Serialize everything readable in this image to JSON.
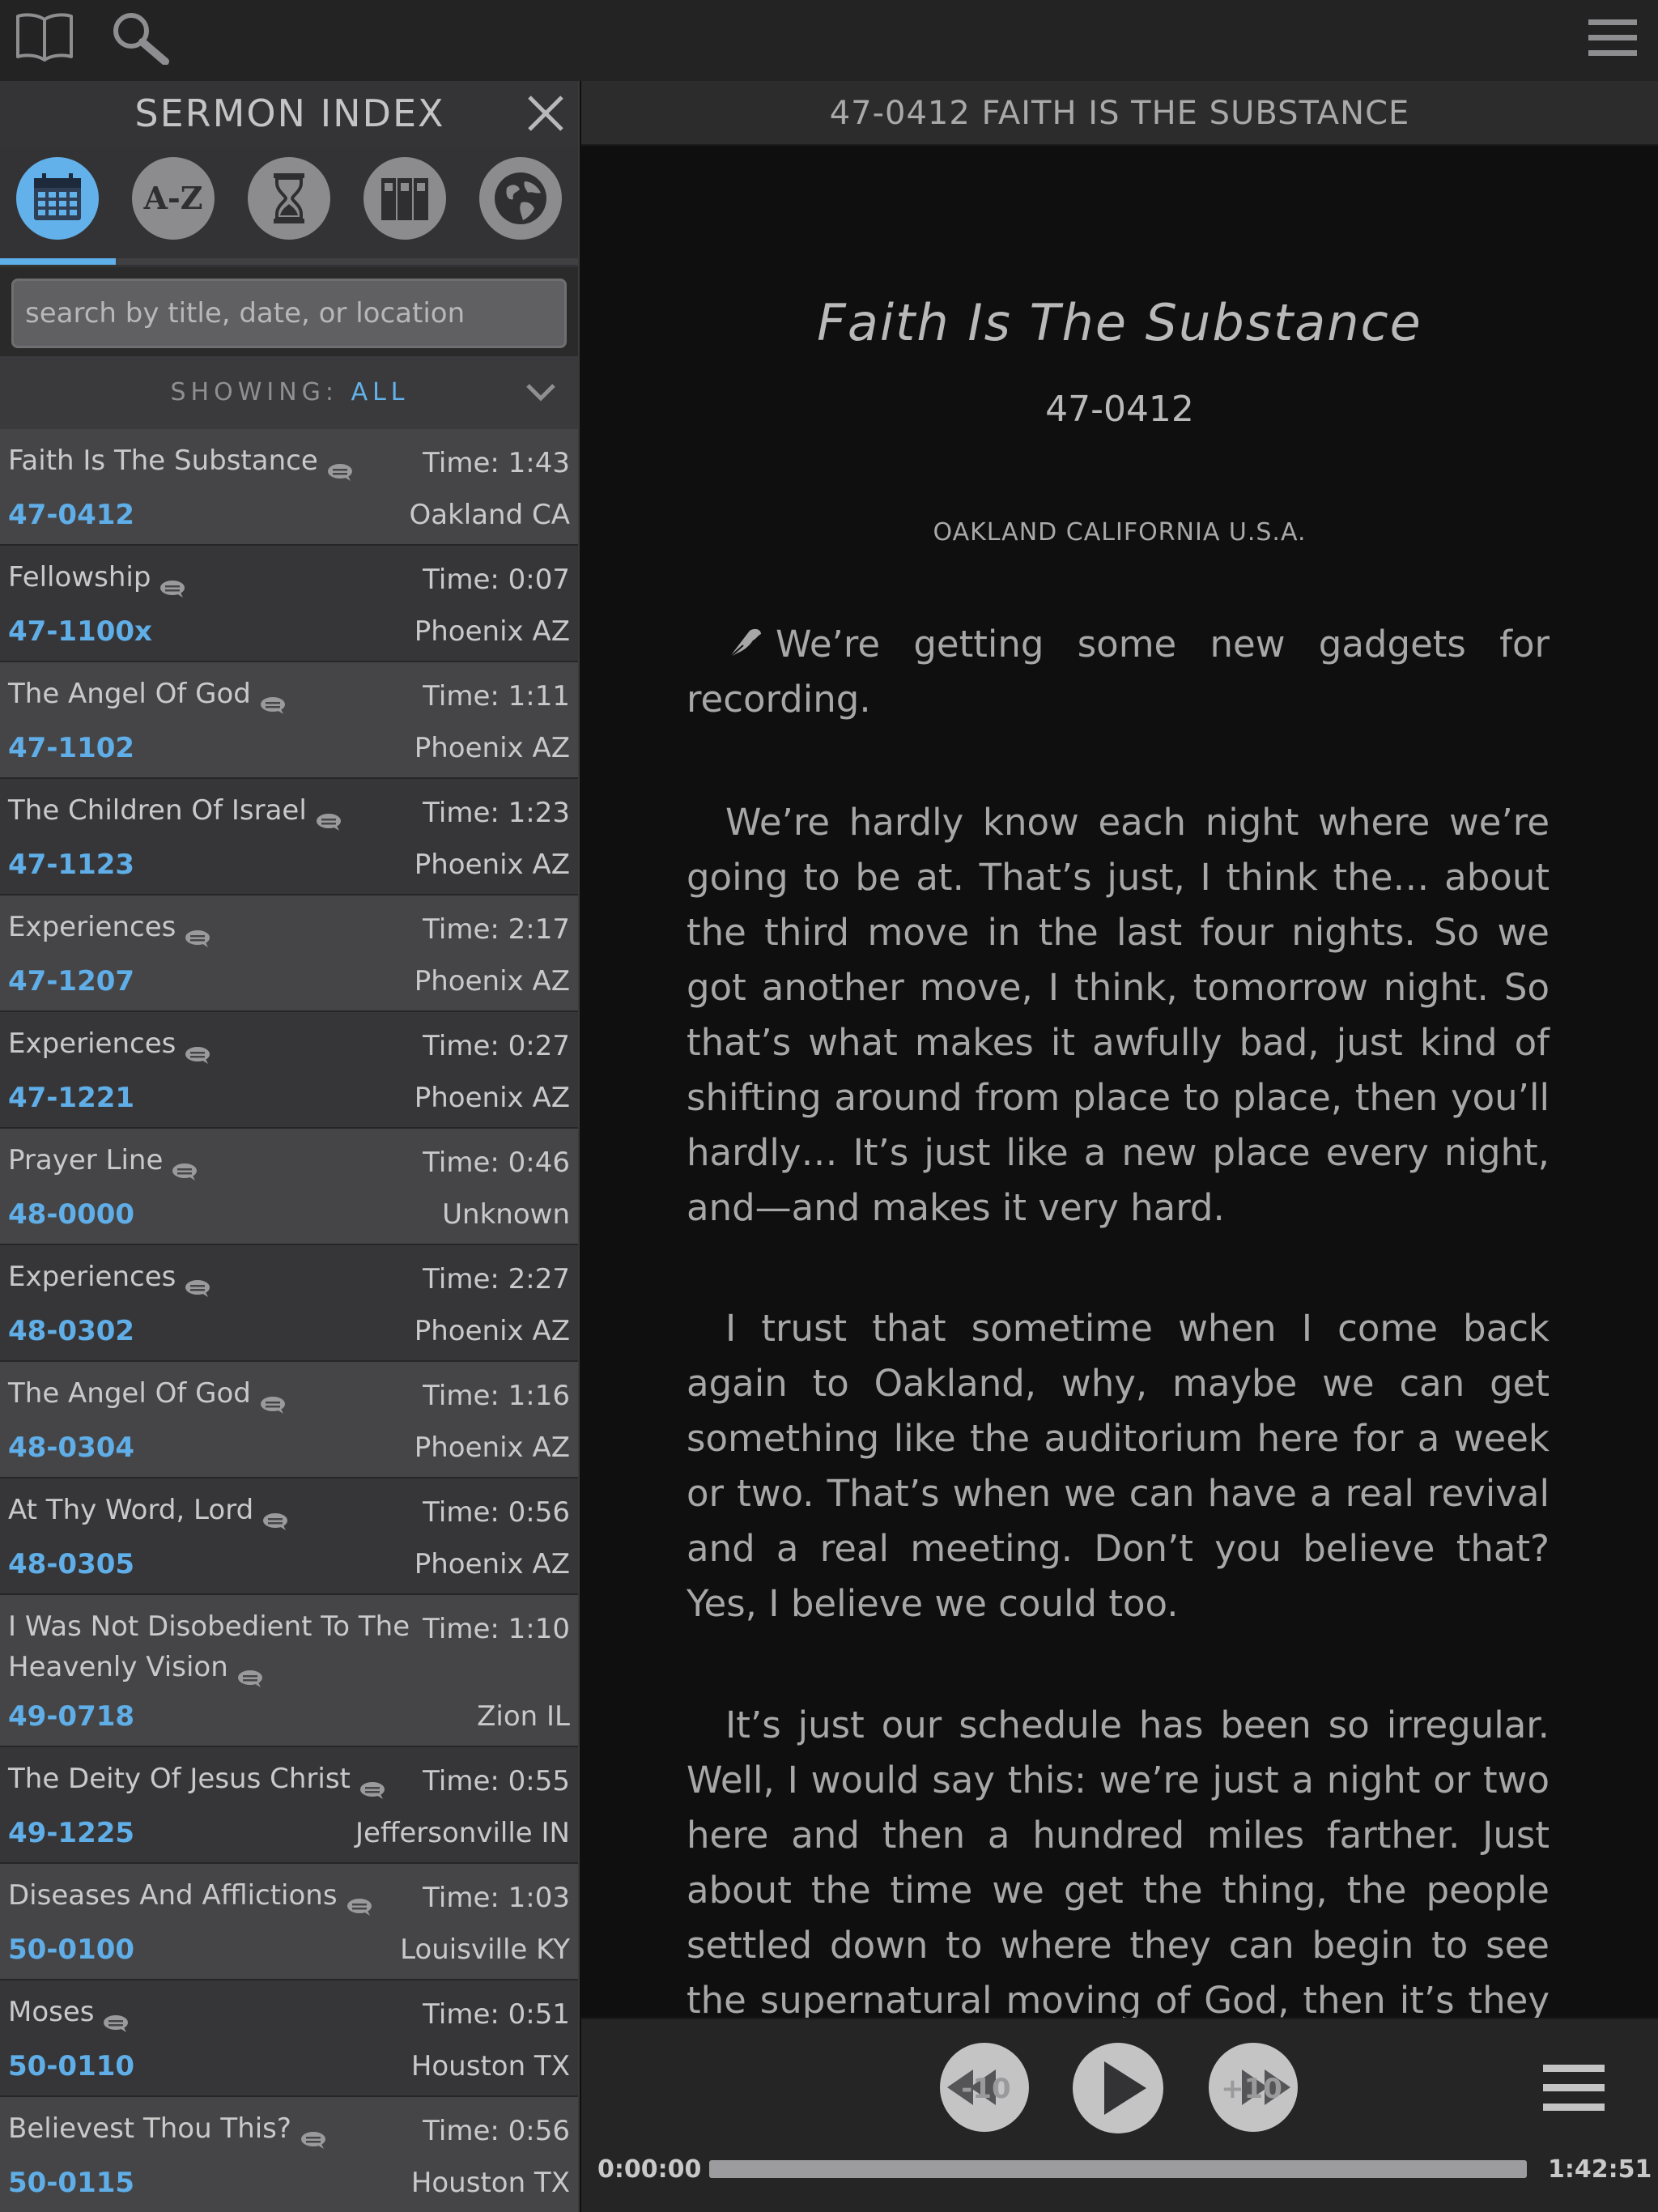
{
  "icons": {
    "book": "book-icon",
    "search": "search-icon",
    "menu": "hamburger-menu-icon",
    "close": "close-icon",
    "chevron": "chevron-down-icon",
    "comment": "comment-bubble-icon"
  },
  "colors": {
    "accent": "#63b1ea",
    "topbar": "#232324",
    "reader_bg": "#0f0f10",
    "row_light": "#454547",
    "row_dark": "#363638"
  },
  "sidebar": {
    "title": "SERMON INDEX",
    "tabs": [
      {
        "name": "date",
        "label": "",
        "active": true
      },
      {
        "name": "a-z",
        "label": "A-Z",
        "active": false
      },
      {
        "name": "duration",
        "label": "",
        "active": false
      },
      {
        "name": "series",
        "label": "",
        "active": false
      },
      {
        "name": "location",
        "label": "",
        "active": false
      }
    ],
    "search_placeholder": "search by title, date, or location",
    "showing_label": "SHOWING:",
    "showing_value": "ALL",
    "sermons": [
      {
        "title": "Faith Is The Substance",
        "code": "47-0412",
        "time": "Time: 1:43",
        "location": "Oakland CA"
      },
      {
        "title": "Fellowship",
        "code": "47-1100x",
        "time": "Time: 0:07",
        "location": "Phoenix AZ"
      },
      {
        "title": "The Angel Of God",
        "code": "47-1102",
        "time": "Time: 1:11",
        "location": "Phoenix AZ"
      },
      {
        "title": "The Children Of Israel",
        "code": "47-1123",
        "time": "Time: 1:23",
        "location": "Phoenix AZ"
      },
      {
        "title": "Experiences",
        "code": "47-1207",
        "time": "Time: 2:17",
        "location": "Phoenix AZ"
      },
      {
        "title": "Experiences",
        "code": "47-1221",
        "time": "Time: 0:27",
        "location": "Phoenix AZ"
      },
      {
        "title": "Prayer Line",
        "code": "48-0000",
        "time": "Time: 0:46",
        "location": "Unknown"
      },
      {
        "title": "Experiences",
        "code": "48-0302",
        "time": "Time: 2:27",
        "location": "Phoenix AZ"
      },
      {
        "title": "The Angel Of God",
        "code": "48-0304",
        "time": "Time: 1:16",
        "location": "Phoenix AZ"
      },
      {
        "title": "At Thy Word, Lord",
        "code": "48-0305",
        "time": "Time: 0:56",
        "location": "Phoenix AZ"
      },
      {
        "title": "I Was Not Disobedient To The",
        "title2": "Heavenly Vision",
        "code": "49-0718",
        "time": "Time: 1:10",
        "location": "Zion IL"
      },
      {
        "title": "The Deity Of Jesus Christ",
        "code": "49-1225",
        "time": "Time: 0:55",
        "location": "Jeffersonville IN"
      },
      {
        "title": "Diseases And Afflictions",
        "code": "50-0100",
        "time": "Time: 1:03",
        "location": "Louisville KY"
      },
      {
        "title": "Moses",
        "code": "50-0110",
        "time": "Time: 0:51",
        "location": "Houston TX"
      },
      {
        "title": "Believest Thou This?",
        "code": "50-0115",
        "time": "Time: 0:56",
        "location": "Houston TX"
      }
    ]
  },
  "reader": {
    "header_title": "47-0412 FAITH IS THE SUBSTANCE",
    "title": "Faith Is The Substance",
    "code": "47-0412",
    "location": "OAKLAND CALIFORNIA U.S.A.",
    "paragraphs": [
      "We’re getting some new gadgets for recording.",
      "We’re hardly know each night where we’re going to be at. That’s just, I think the… about the third move in the last four nights. So we got another move, I think, tomorrow night. So that’s what makes it awfully bad, just kind of shifting around from place to place, then you’ll hardly… It’s just like a new place every night, and—and makes it very hard.",
      "I trust that sometime when I come back again to Oakland, why, maybe we can get something like the auditorium here for a week or two. That’s when we can have a real revival and a real meeting. Don’t you believe that? Yes, I believe we could too.",
      "It’s just our schedule has been so irregular. Well, I would say this: we’re just a night or two here and then a hundred miles farther. Just about the time we get the thing, the people settled down to where they can begin to see the supernatural moving of God, then it’s they break"
    ]
  },
  "player": {
    "rewind_label": "-10",
    "forward_label": "+10",
    "current_time": "0:00:00",
    "total_time": "1:42:51",
    "progress": 0.0
  }
}
